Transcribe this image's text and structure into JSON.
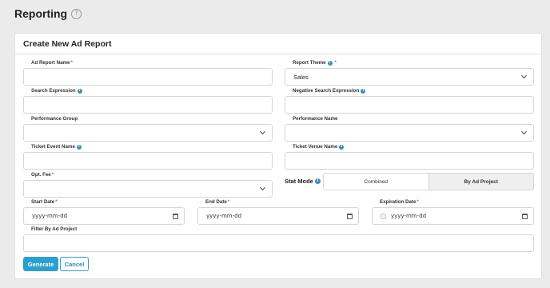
{
  "page": {
    "title": "Reporting"
  },
  "form": {
    "title": "Create New Ad Report",
    "ad_report_name": {
      "label": "Ad Report Name",
      "value": ""
    },
    "report_theme": {
      "label": "Report Theme",
      "value": "Sales"
    },
    "search_expression": {
      "label": "Search Expression",
      "value": ""
    },
    "negative_search_expression": {
      "label": "Negative Search Expression",
      "value": ""
    },
    "performance_group": {
      "label": "Performance Group",
      "value": ""
    },
    "performance_name": {
      "label": "Performance Name",
      "value": ""
    },
    "ticket_event_name": {
      "label": "Ticket Event Name",
      "value": ""
    },
    "ticket_venue_name": {
      "label": "Ticket Venue Name",
      "value": ""
    },
    "opt_fee": {
      "label": "Opt. Fee",
      "value": ""
    },
    "stat_mode": {
      "label": "Stat Mode",
      "options": [
        "Combined",
        "By Ad Project"
      ],
      "selected": "By Ad Project"
    },
    "start_date": {
      "label": "Start Date",
      "placeholder": "yyyy-mm-dd"
    },
    "end_date": {
      "label": "End Date",
      "placeholder": "yyyy-mm-dd"
    },
    "expiration_date": {
      "label": "Expiration Date",
      "placeholder": "yyyy-mm-dd"
    },
    "filter_by_ad_project": {
      "label": "Filter By Ad Project",
      "value": ""
    },
    "buttons": {
      "generate": "Generate",
      "cancel": "Cancel"
    }
  },
  "icons": {
    "help": "question-circle-icon",
    "info": "info-icon",
    "dropdown": "chevron-down-icon",
    "calendar": "calendar-icon"
  },
  "colors": {
    "primary": "#2b9fd0",
    "required": "#d9534f",
    "info": "#3a8ccc"
  }
}
